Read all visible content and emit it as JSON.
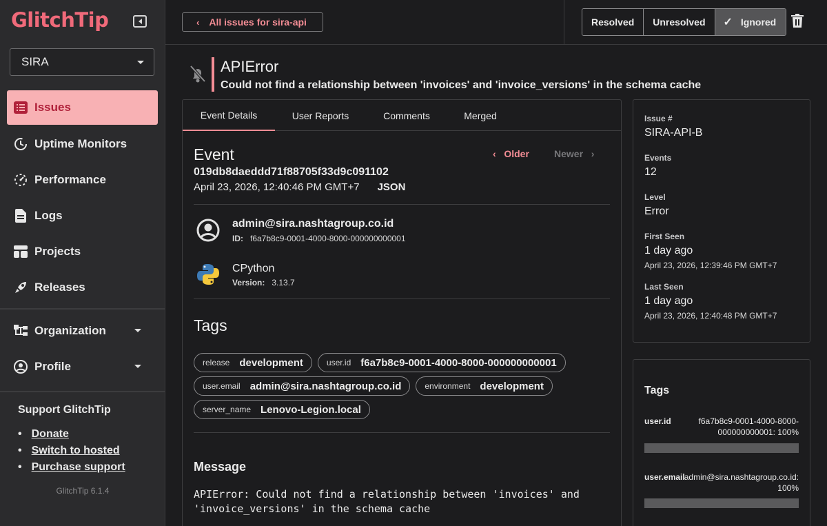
{
  "app": {
    "logo": "GlitchTip",
    "version": "GlitchTip 6.1.4"
  },
  "sidebar": {
    "org": "SIRA",
    "items": [
      {
        "label": "Issues",
        "icon": "issues-icon",
        "active": true
      },
      {
        "label": "Uptime Monitors",
        "icon": "uptime-icon"
      },
      {
        "label": "Performance",
        "icon": "performance-icon"
      },
      {
        "label": "Logs",
        "icon": "logs-icon"
      },
      {
        "label": "Projects",
        "icon": "projects-icon"
      },
      {
        "label": "Releases",
        "icon": "releases-icon"
      }
    ],
    "organization": "Organization",
    "profile": "Profile",
    "support_title": "Support GlitchTip",
    "support_links": [
      "Donate",
      "Switch to hosted",
      "Purchase support"
    ]
  },
  "topbar": {
    "back_label": "All issues for sira-api",
    "status": {
      "resolved": "Resolved",
      "unresolved": "Unresolved",
      "ignored": "Ignored"
    }
  },
  "issue": {
    "title": "APIError",
    "subtitle": "Could not find a relationship between 'invoices' and 'invoice_versions' in the schema cache"
  },
  "tabs": [
    "Event Details",
    "User Reports",
    "Comments",
    "Merged"
  ],
  "event": {
    "heading": "Event",
    "id": "019db8daeddd71f88705f33d9c091102",
    "date": "April 23, 2026, 12:40:46 PM GMT+7",
    "json_label": "JSON",
    "older": "Older",
    "newer": "Newer",
    "user_email": "admin@sira.nashtagroup.co.id",
    "user_id_label": "ID:",
    "user_id": "f6a7b8c9-0001-4000-8000-000000000001",
    "runtime": "CPython",
    "runtime_version_label": "Version:",
    "runtime_version": "3.13.7"
  },
  "tags_heading": "Tags",
  "tags": [
    {
      "key": "release",
      "value": "development"
    },
    {
      "key": "user.id",
      "value": "f6a7b8c9-0001-4000-8000-000000000001"
    },
    {
      "key": "user.email",
      "value": "admin@sira.nashtagroup.co.id"
    },
    {
      "key": "environment",
      "value": "development"
    },
    {
      "key": "server_name",
      "value": "Lenovo-Legion.local"
    }
  ],
  "message": {
    "heading": "Message",
    "body": "APIError: Could not find a relationship between 'invoices' and 'invoice_versions' in the schema cache"
  },
  "side": {
    "issue_label": "Issue #",
    "issue_value": "SIRA-API-B",
    "events_label": "Events",
    "events_value": "12",
    "level_label": "Level",
    "level_value": "Error",
    "first_label": "First Seen",
    "first_value": "1 day ago",
    "first_date": "April 23, 2026, 12:39:46 PM GMT+7",
    "last_label": "Last Seen",
    "last_value": "1 day ago",
    "last_date": "April 23, 2026, 12:40:48 PM GMT+7"
  },
  "side_tags": {
    "heading": "Tags",
    "items": [
      {
        "key": "user.id",
        "value_line1": "f6a7b8c9-0001-4000-8000-",
        "value_line2": "000000000001: 100%",
        "percent": 100
      },
      {
        "key": "user.email",
        "value_line1": "admin@sira.nashtagroup.co.id:",
        "value_line2": "100%",
        "percent": 100
      }
    ]
  }
}
